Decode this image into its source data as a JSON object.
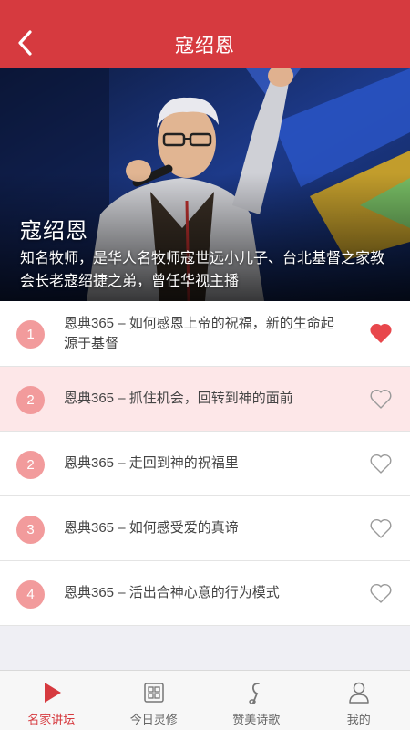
{
  "header": {
    "title": "寇绍恩"
  },
  "hero": {
    "name": "寇绍恩",
    "description": "知名牧师，是华人名牧师寇世远小儿子、台北基督之家教会长老寇绍捷之弟，曾任华视主播"
  },
  "sermons": [
    {
      "number": "1",
      "title": "恩典365 – 如何感恩上帝的祝福，新的生命起源于基督",
      "liked": true
    },
    {
      "number": "2",
      "title": "恩典365 – 抓住机会，回转到神的面前",
      "liked": false
    },
    {
      "number": "2",
      "title": "恩典365 – 走回到神的祝福里",
      "liked": false
    },
    {
      "number": "3",
      "title": "恩典365 – 如何感受爱的真谛",
      "liked": false
    },
    {
      "number": "4",
      "title": "恩典365 – 活出合神心意的行为模式",
      "liked": false
    }
  ],
  "tabs": [
    {
      "label": "名家讲坛",
      "icon": "play-icon",
      "active": true
    },
    {
      "label": "今日灵修",
      "icon": "grid-icon",
      "active": false
    },
    {
      "label": "赞美诗歌",
      "icon": "music-note-icon",
      "active": false
    },
    {
      "label": "我的",
      "icon": "user-icon",
      "active": false
    }
  ],
  "colors": {
    "accent": "#d63a3f",
    "badge": "#f29b9c",
    "selected_row": "#fde7e8"
  }
}
